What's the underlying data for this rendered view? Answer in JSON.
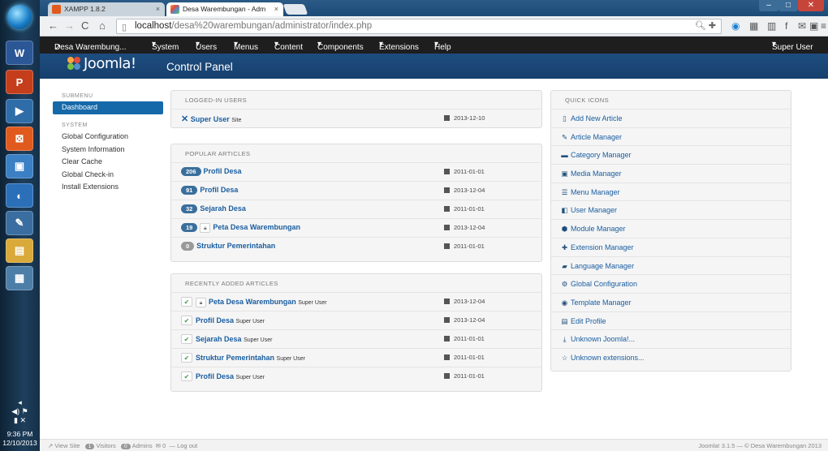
{
  "browser": {
    "tabs": [
      {
        "title": "XAMPP 1.8.2"
      },
      {
        "title": "Desa Warembungan - Adm"
      }
    ],
    "address_host": "localhost",
    "address_path": "/desa%20warembungan/administrator/index.php"
  },
  "joomla_menu": {
    "site_name": "Desa Warembung...",
    "items": [
      "System",
      "Users",
      "Menus",
      "Content",
      "Components",
      "Extensions",
      "Help"
    ],
    "user": "Super User"
  },
  "header": {
    "logo": "Joomla!",
    "title": "Control Panel"
  },
  "sidebar": {
    "submenu_heading": "SUBMENU",
    "dashboard": "Dashboard",
    "system_heading": "SYSTEM",
    "items": [
      "Global Configuration",
      "System Information",
      "Clear Cache",
      "Global Check-in",
      "Install Extensions"
    ]
  },
  "logged_in": {
    "heading": "LOGGED-IN USERS",
    "user": "Super User",
    "where": "Site",
    "date": "2013-12-10"
  },
  "popular": {
    "heading": "POPULAR ARTICLES",
    "rows": [
      {
        "hits": "206",
        "title": "Profil Desa",
        "date": "2011-01-01"
      },
      {
        "hits": "91",
        "title": "Profil Desa",
        "date": "2013-12-04"
      },
      {
        "hits": "32",
        "title": "Sejarah Desa",
        "date": "2011-01-01"
      },
      {
        "hits": "19",
        "title": "Peta Desa Warembungan",
        "date": "2013-12-04"
      },
      {
        "hits": "0",
        "title": "Struktur Pemerintahan",
        "date": "2011-01-01"
      }
    ]
  },
  "recent": {
    "heading": "RECENTLY ADDED ARTICLES",
    "rows": [
      {
        "title": "Peta Desa Warembungan",
        "author": "Super User",
        "date": "2013-12-04"
      },
      {
        "title": "Profil Desa",
        "author": "Super User",
        "date": "2013-12-04"
      },
      {
        "title": "Sejarah Desa",
        "author": "Super User",
        "date": "2011-01-01"
      },
      {
        "title": "Struktur Pemerintahan",
        "author": "Super User",
        "date": "2011-01-01"
      },
      {
        "title": "Profil Desa",
        "author": "Super User",
        "date": "2011-01-01"
      }
    ]
  },
  "quick_icons": {
    "heading": "QUICK ICONS",
    "items": [
      {
        "label": "Add New Article",
        "icon": "file-add-icon"
      },
      {
        "label": "Article Manager",
        "icon": "pencil-icon"
      },
      {
        "label": "Category Manager",
        "icon": "folder-icon"
      },
      {
        "label": "Media Manager",
        "icon": "image-icon"
      },
      {
        "label": "Menu Manager",
        "icon": "list-icon"
      },
      {
        "label": "User Manager",
        "icon": "user-icon"
      },
      {
        "label": "Module Manager",
        "icon": "cube-icon"
      },
      {
        "label": "Extension Manager",
        "icon": "puzzle-icon"
      },
      {
        "label": "Language Manager",
        "icon": "comments-icon"
      },
      {
        "label": "Global Configuration",
        "icon": "cog-icon"
      },
      {
        "label": "Template Manager",
        "icon": "eye-icon"
      },
      {
        "label": "Edit Profile",
        "icon": "card-icon"
      },
      {
        "label": "Unknown Joomla!...",
        "icon": "download-icon"
      },
      {
        "label": "Unknown extensions...",
        "icon": "star-icon"
      }
    ]
  },
  "footer": {
    "view_site": "View Site",
    "visitors_count": "1",
    "visitors": "Visitors",
    "admins_count": "0",
    "admins": "Admins",
    "messages": "0",
    "logout": "Log out",
    "copyright": "Joomla! 3.1.5 — © Desa Warembungan 2013"
  },
  "clock": {
    "time": "9:36 PM",
    "date": "12/10/2013"
  },
  "colors": {
    "joomla_blue": "#1669a9",
    "header_blue": "#1d4d80",
    "link": "#1a5ea0",
    "menubar": "#1e1e1e"
  }
}
